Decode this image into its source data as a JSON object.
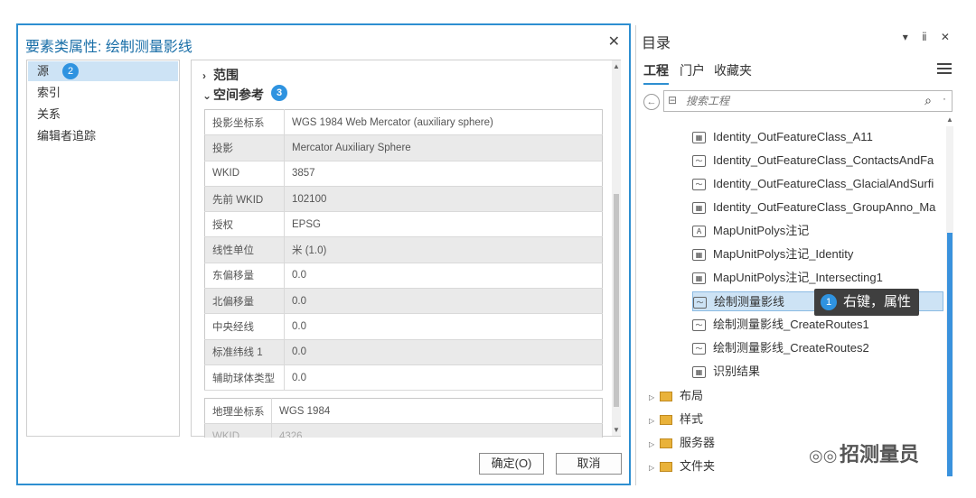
{
  "dialog": {
    "title": "要素类属性: 绘制测量影线",
    "close": "✕",
    "nav": [
      "源",
      "索引",
      "关系",
      "编辑者追踪"
    ],
    "nav_badge": "2",
    "sections": [
      {
        "label": "范围",
        "chevron": "›"
      },
      {
        "label": "空间参考",
        "chevron": "⌄",
        "badge": "3"
      }
    ],
    "properties": [
      {
        "key": "投影坐标系",
        "value": "WGS 1984 Web Mercator (auxiliary sphere)"
      },
      {
        "key": "投影",
        "value": "Mercator Auxiliary Sphere"
      },
      {
        "key": "WKID",
        "value": "3857"
      },
      {
        "key": "先前 WKID",
        "value": "102100"
      },
      {
        "key": "授权",
        "value": "EPSG"
      },
      {
        "key": "线性单位",
        "value": "米 (1.0)"
      },
      {
        "key": "东偏移量",
        "value": "0.0"
      },
      {
        "key": "北偏移量",
        "value": "0.0"
      },
      {
        "key": "中央经线",
        "value": "0.0"
      },
      {
        "key": "标准纬线 1",
        "value": "0.0"
      },
      {
        "key": "辅助球体类型",
        "value": "0.0"
      }
    ],
    "geographic": [
      {
        "key": "地理坐标系",
        "value": "WGS 1984"
      },
      {
        "key": "WKID",
        "value": "4326"
      }
    ],
    "buttons": {
      "ok": "确定(O)",
      "cancel": "取消"
    }
  },
  "catalog": {
    "title": "目录",
    "controls": "▾ ⅱ ✕",
    "tabs": [
      "工程",
      "门户",
      "收藏夹"
    ],
    "search_placeholder": "搜索工程",
    "items": [
      {
        "icon": "table-icon",
        "label": "Identity_OutFeatureClass_A11"
      },
      {
        "icon": "line-feature-icon",
        "label": "Identity_OutFeatureClass_ContactsAndFa"
      },
      {
        "icon": "line-feature-icon",
        "label": "Identity_OutFeatureClass_GlacialAndSurfi"
      },
      {
        "icon": "table-icon",
        "label": "Identity_OutFeatureClass_GroupAnno_Ma"
      },
      {
        "icon": "annotation-icon",
        "label": "MapUnitPolys注记"
      },
      {
        "icon": "table-icon",
        "label": "MapUnitPolys注记_Identity"
      },
      {
        "icon": "table-icon",
        "label": "MapUnitPolys注记_Intersecting1"
      },
      {
        "icon": "line-feature-icon",
        "label": "绘制测量影线"
      },
      {
        "icon": "line-feature-icon",
        "label": "绘制测量影线_CreateRoutes1"
      },
      {
        "icon": "line-feature-icon",
        "label": "绘制测量影线_CreateRoutes2"
      },
      {
        "icon": "table-icon",
        "label": "识别结果"
      }
    ],
    "folders": [
      "布局",
      "样式",
      "服务器",
      "文件夹"
    ],
    "tooltip": {
      "badge": "1",
      "text": "右键，属性"
    }
  },
  "watermark": "招测量员"
}
